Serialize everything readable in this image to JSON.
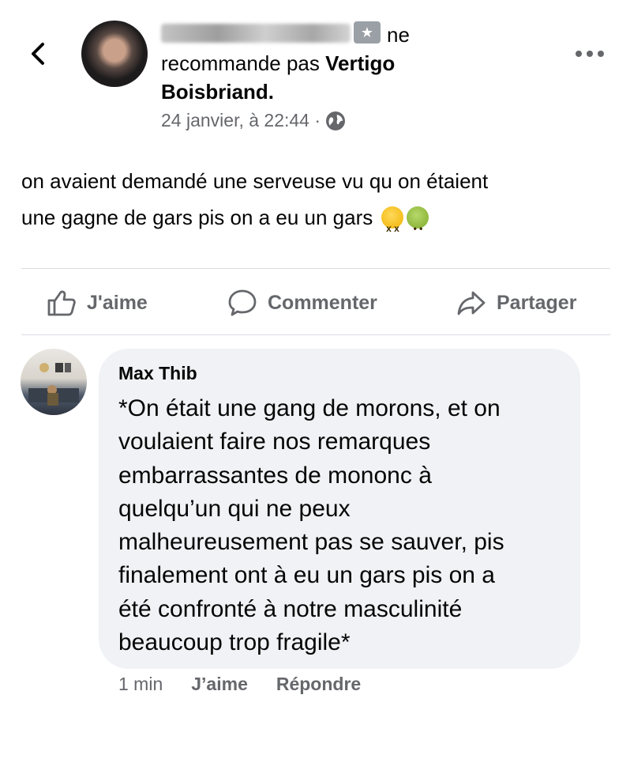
{
  "post": {
    "author_suffix": "ne",
    "action_text": "recommande pas",
    "page_name_part1": "Vertigo",
    "page_name_part2": "Boisbriand.",
    "timestamp": "24 janvier, à 22:44 ·",
    "body_line1": "on avaient demandé une serveuse vu qu on étaient",
    "body_line2": "une gagne de gars pis on a eu un gars",
    "emojis": [
      "face-vomiting-icon",
      "nauseated-face-icon"
    ]
  },
  "actions": {
    "like": "J'aime",
    "comment": "Commenter",
    "share": "Partager"
  },
  "comment": {
    "author": "Max Thib",
    "lines": [
      "*On était une gang de morons, et on",
      "voulaient faire nos remarques",
      "embarrassantes de mononc à",
      "quelqu’un qui ne peux",
      "malheureusement pas se sauver, pis",
      "finalement ont à eu un gars pis on a",
      "été confronté à notre masculinité",
      "beaucoup trop fragile*"
    ],
    "time": "1 min",
    "like": "J’aime",
    "reply": "Répondre"
  },
  "colors": {
    "text": "#050505",
    "secondary": "#65676b",
    "bubble": "#f0f2f5",
    "divider": "#dadde1"
  }
}
